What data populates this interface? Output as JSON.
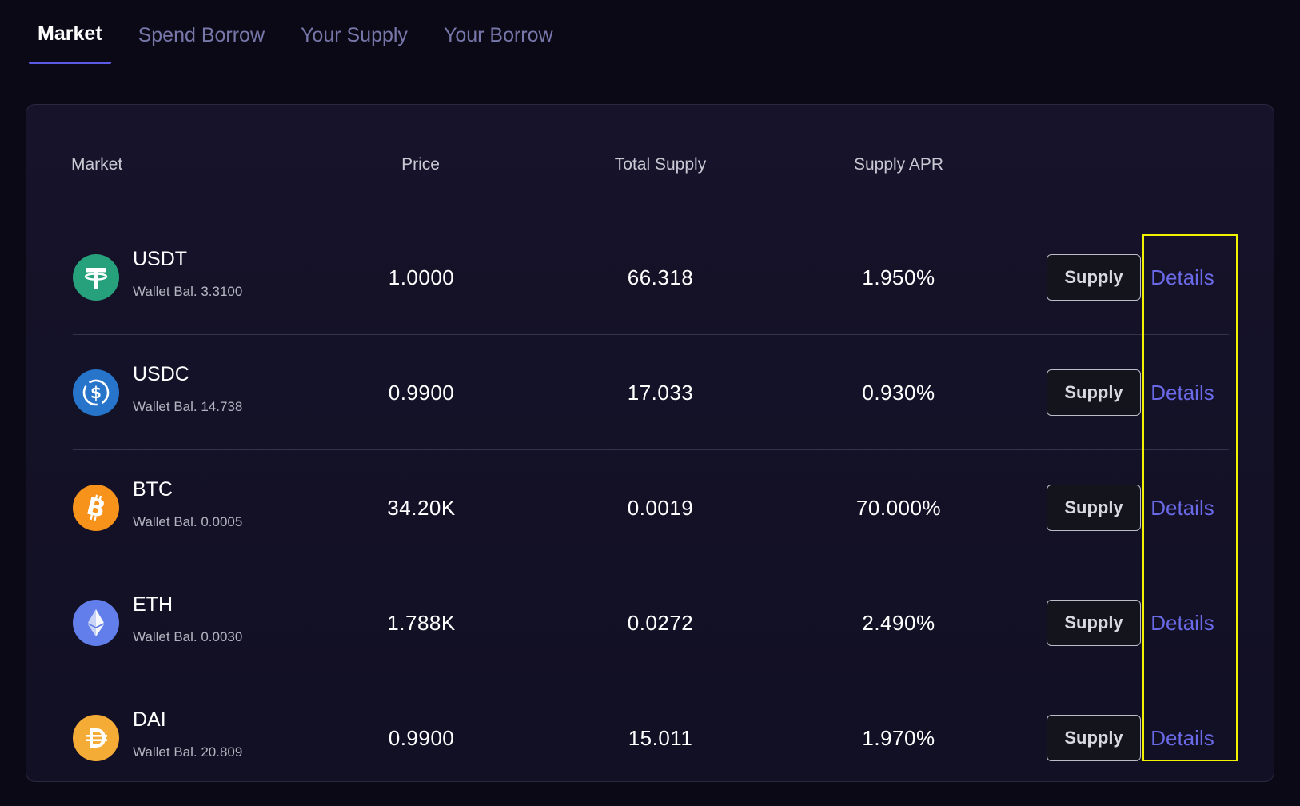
{
  "tabs": [
    {
      "label": "Market",
      "active": true
    },
    {
      "label": "Spend Borrow",
      "active": false
    },
    {
      "label": "Your Supply",
      "active": false
    },
    {
      "label": "Your Borrow",
      "active": false
    }
  ],
  "table": {
    "headers": {
      "market": "Market",
      "price": "Price",
      "total_supply": "Total Supply",
      "supply_apr": "Supply APR"
    },
    "rows": [
      {
        "symbol": "USDT",
        "wallet": "Wallet Bal. 3.3100",
        "price": "1.0000",
        "total_supply": "66.318",
        "apr": "1.950%",
        "supply_label": "Supply",
        "details_label": "Details",
        "icon": "tether-icon",
        "color": "#26a17b"
      },
      {
        "symbol": "USDC",
        "wallet": "Wallet Bal. 14.738",
        "price": "0.9900",
        "total_supply": "17.033",
        "apr": "0.930%",
        "supply_label": "Supply",
        "details_label": "Details",
        "icon": "usdc-icon",
        "color": "#2775ca"
      },
      {
        "symbol": "BTC",
        "wallet": "Wallet Bal. 0.0005",
        "price": "34.20K",
        "total_supply": "0.0019",
        "apr": "70.000%",
        "supply_label": "Supply",
        "details_label": "Details",
        "icon": "bitcoin-icon",
        "color": "#f7931a"
      },
      {
        "symbol": "ETH",
        "wallet": "Wallet Bal. 0.0030",
        "price": "1.788K",
        "total_supply": "0.0272",
        "apr": "2.490%",
        "supply_label": "Supply",
        "details_label": "Details",
        "icon": "ethereum-icon",
        "color": "#627eea"
      },
      {
        "symbol": "DAI",
        "wallet": "Wallet Bal. 20.809",
        "price": "0.9900",
        "total_supply": "15.011",
        "apr": "1.970%",
        "supply_label": "Supply",
        "details_label": "Details",
        "icon": "dai-icon",
        "color": "#f5ac37"
      }
    ]
  },
  "colors": {
    "accent": "#5b5be6",
    "link": "#6a6ae8",
    "highlight": "#f2f200",
    "background": "#0b0916"
  }
}
